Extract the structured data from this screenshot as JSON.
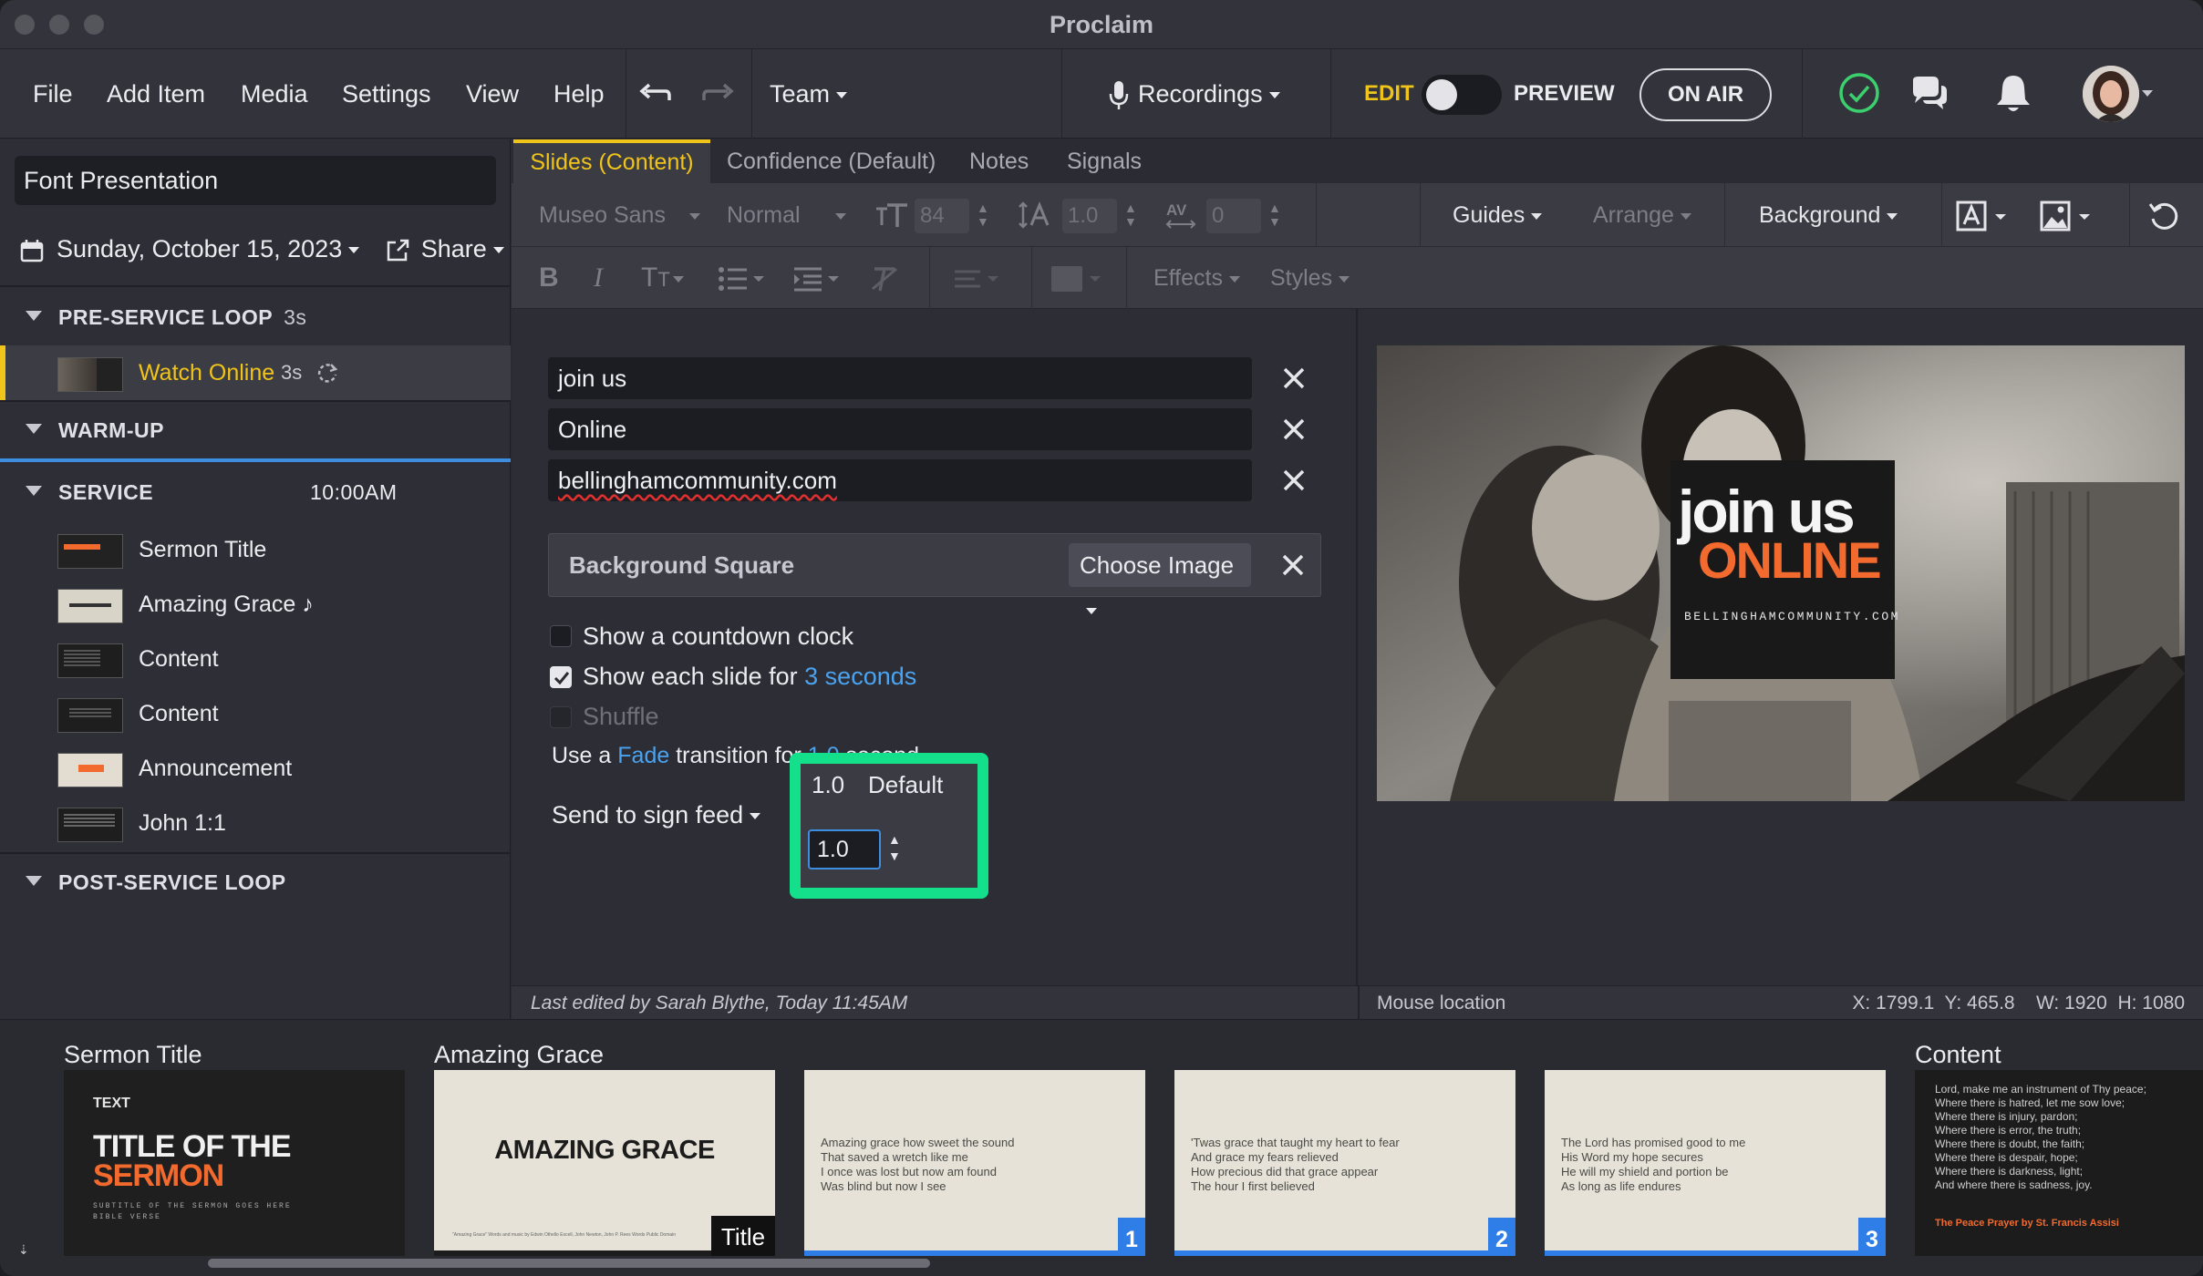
{
  "window": {
    "title": "Proclaim"
  },
  "menu": {
    "items": [
      "File",
      "Add Item",
      "Media",
      "Settings",
      "View",
      "Help"
    ],
    "team": "Team",
    "recordings": "Recordings",
    "edit": "EDIT",
    "preview": "PREVIEW",
    "on_air": "ON AIR"
  },
  "sidebar": {
    "presentation": "Font Presentation",
    "date": "Sunday, October 15, 2023",
    "share": "Share",
    "sections": [
      {
        "name": "PRE-SERVICE LOOP",
        "extra": "3s"
      },
      {
        "name": "WARM-UP",
        "extra": ""
      },
      {
        "name": "SERVICE",
        "extra": "10:00AM"
      },
      {
        "name": "POST-SERVICE LOOP",
        "extra": ""
      }
    ],
    "pre_item": {
      "label": "Watch Online",
      "duration": "3s"
    },
    "service_items": [
      "Sermon Title",
      "Amazing Grace ♪",
      "Content",
      "Content",
      "Announcement",
      "John 1:1"
    ]
  },
  "tabs": [
    "Slides (Content)",
    "Confidence (Default)",
    "Notes",
    "Signals"
  ],
  "toolbar": {
    "font": "Museo Sans",
    "weight": "Normal",
    "size": "84",
    "line_height": "1.0",
    "spacing": "0",
    "guides": "Guides",
    "arrange": "Arrange",
    "background": "Background",
    "effects": "Effects",
    "styles": "Styles"
  },
  "editor": {
    "fields": [
      "join us",
      "Online",
      "bellinghamcommunity.com"
    ],
    "bg_square": "Background Square",
    "choose_image": "Choose Image",
    "countdown": "Show a countdown clock",
    "show_each_pre": "Show each slide for",
    "show_each_val": "3 seconds",
    "shuffle": "Shuffle",
    "trans_pre": "Use a",
    "trans_fade": "Fade",
    "trans_mid": "transition",
    "trans_for": "for",
    "trans_val": "1.0",
    "trans_post": "second",
    "sign_feed": "Send to sign feed",
    "popup": {
      "value": "1.0",
      "default": "Default",
      "input": "1.0"
    },
    "show_countdown_checked": false,
    "show_each_checked": true
  },
  "slide_preview": {
    "join": "join us",
    "online": "ONLINE",
    "url": "BELLINGHAMCOMMUNITY.COM"
  },
  "status": {
    "edited": "Last edited by Sarah Blythe, Today 11:45AM",
    "mouse": "Mouse location",
    "coords": "X: 1799.1  Y: 465.8    W: 1920  H: 1080"
  },
  "strip": {
    "groups": [
      "Sermon Title",
      "Amazing Grace",
      "Content"
    ],
    "sermon": {
      "small": "TEXT",
      "title1": "TITLE OF THE",
      "title2": "SERMON",
      "sub": "SUBTITLE OF THE SERMON GOES HERE\nBIBLE VERSE"
    },
    "amazing": {
      "title": "AMAZING GRACE",
      "caption": "\"Amazing Grace\" Words and music by Edwin Othello Excell, John Newton, John P. Rees Words Public Domain",
      "badge": "Title"
    },
    "verse1": {
      "text": "Amazing grace how sweet the sound\nThat saved a wretch like me\nI once was lost but now am found\nWas blind but now I see",
      "num": "1"
    },
    "verse2": {
      "text": "'Twas grace that taught my heart to fear\nAnd grace my fears relieved\nHow precious did that grace appear\nThe hour I first believed",
      "num": "2"
    },
    "verse3": {
      "text": "The Lord has promised good to me\nHis Word my hope secures\nHe will my shield and portion be\nAs long as life endures",
      "num": "3"
    },
    "content": {
      "text": "Lord, make me an instrument of Thy peace;\nWhere there is hatred, let me sow love;\nWhere there is injury, pardon;\nWhere there is error, the truth;\nWhere there is doubt, the faith;\nWhere there is despair, hope;\nWhere there is darkness, light;\nAnd where there is sadness, joy.",
      "credit": "The Peace Prayer by St. Francis Assisi"
    }
  },
  "colors": {
    "accent": "#f0c419",
    "link": "#4aa3f0",
    "highlight": "#14e08c",
    "orange": "#f26a2e"
  }
}
